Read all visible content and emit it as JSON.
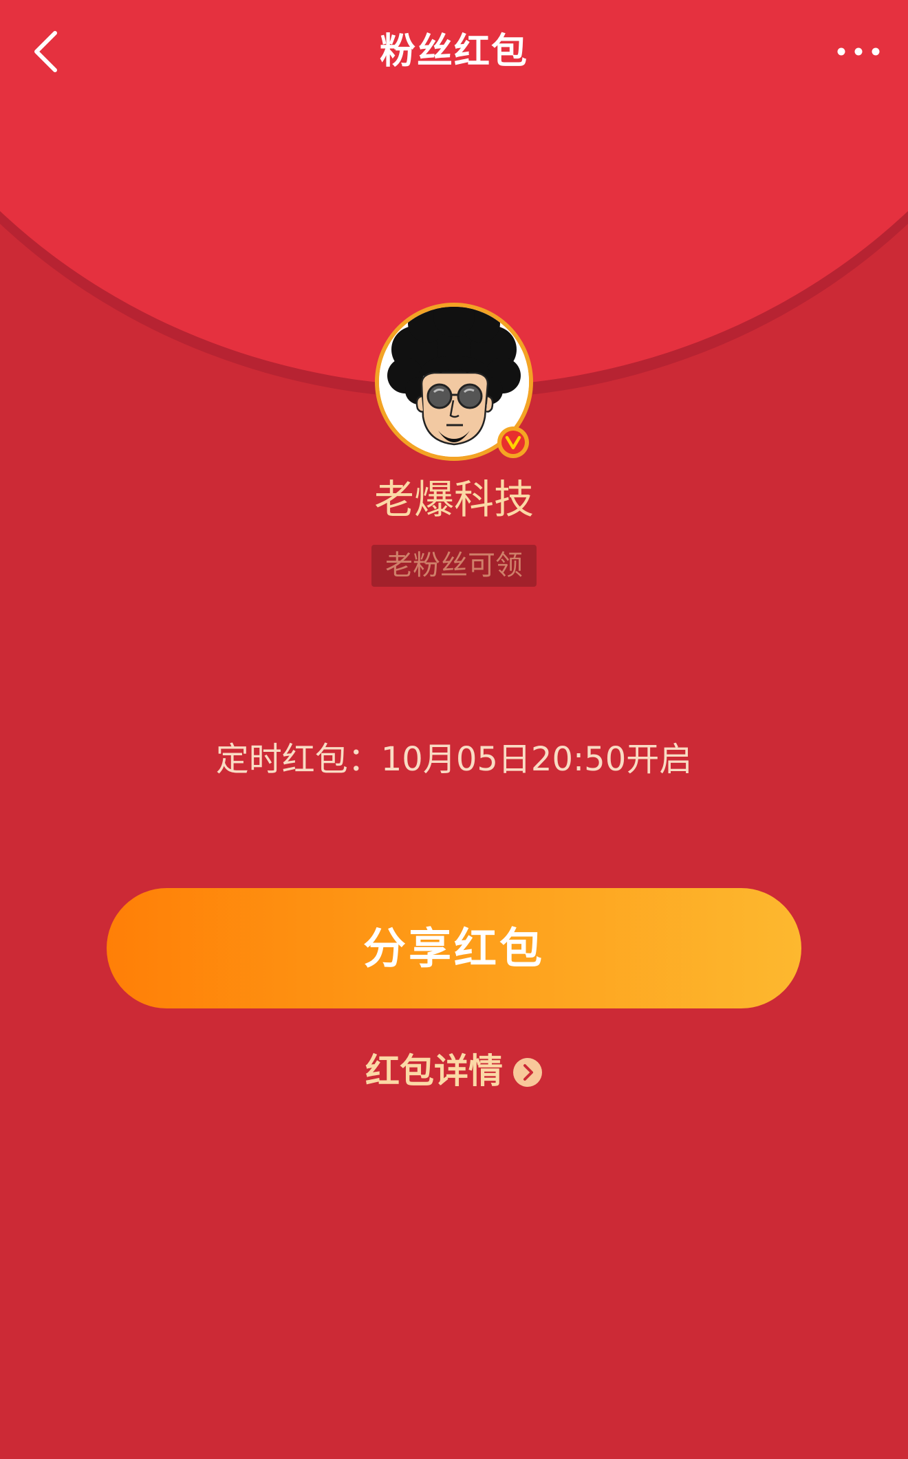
{
  "header": {
    "title": "粉丝红包"
  },
  "packet": {
    "author_name": "老爆科技",
    "audience_tag": "老粉丝可领",
    "timer_text": "定时红包：10月05日20:50开启",
    "share_label": "分享红包",
    "details_label": "红包详情"
  },
  "icons": {
    "back": "chevron-left-icon",
    "more": "more-dots-icon",
    "verified": "verified-v-badge-icon",
    "details_arrow": "chevron-right-circle-icon"
  },
  "colors": {
    "flap": "#e5313f",
    "body": "#cc2a36",
    "gold_text": "#fbd9a6",
    "button_start": "#ff7f07",
    "button_end": "#fdb82f",
    "verified_badge": "#f3a325"
  }
}
